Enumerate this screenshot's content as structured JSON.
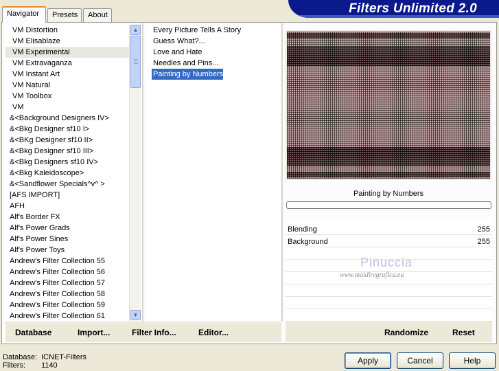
{
  "tabs": [
    {
      "label": "Navigator"
    },
    {
      "label": "Presets"
    },
    {
      "label": "About"
    }
  ],
  "banner": {
    "title": "Filters Unlimited 2.0"
  },
  "categories": [
    "VM Distortion",
    "VM Elisablaze",
    "VM Experimental",
    "VM Extravaganza",
    "VM Instant Art",
    "VM Natural",
    "VM Toolbox",
    "VM",
    "&<Background Designers IV>",
    "&<Bkg Designer sf10 I>",
    "&<BKg Designer sf10 II>",
    "&<Bkg Designer sf10 III>",
    "&<Bkg Designers sf10 IV>",
    "&<Bkg Kaleidoscope>",
    "&<Sandflower Specials^v^ >",
    "[AFS IMPORT]",
    "AFH",
    "Alf's Border FX",
    "Alf's Power Grads",
    "Alf's Power Sines",
    "Alf's Power Toys",
    "Andrew's Filter Collection 55",
    "Andrew's Filter Collection 56",
    "Andrew's Filter Collection 57",
    "Andrew's Filter Collection 58",
    "Andrew's Filter Collection 59",
    "Andrew's Filter Collection 61"
  ],
  "selected_category": "VM Experimental",
  "filters": [
    "Every Picture Tells A Story",
    "Guess  What?...",
    "Love and Hate",
    "Needles and Pins...",
    "Painting by Numbers"
  ],
  "selected_filter": "Painting by Numbers",
  "preview": {
    "filter_name": "Painting by Numbers"
  },
  "params": [
    {
      "label": "Blending",
      "value": "255"
    },
    {
      "label": "Background",
      "value": "255"
    }
  ],
  "watermark": {
    "name": "Pinuccia",
    "url": "www.maidiregrafica.eu"
  },
  "toolbar": {
    "database": "Database",
    "import": "Import...",
    "filter_info": "Filter Info...",
    "editor": "Editor...",
    "randomize": "Randomize",
    "reset": "Reset"
  },
  "footer": {
    "database_label": "Database:",
    "database_value": "ICNET-Filters",
    "filters_label": "Filters:",
    "filters_value": "1140",
    "apply": "Apply",
    "cancel": "Cancel",
    "help": "Help"
  },
  "scroll_icons": {
    "up": "chevron-up-icon",
    "down": "chevron-down-icon"
  }
}
